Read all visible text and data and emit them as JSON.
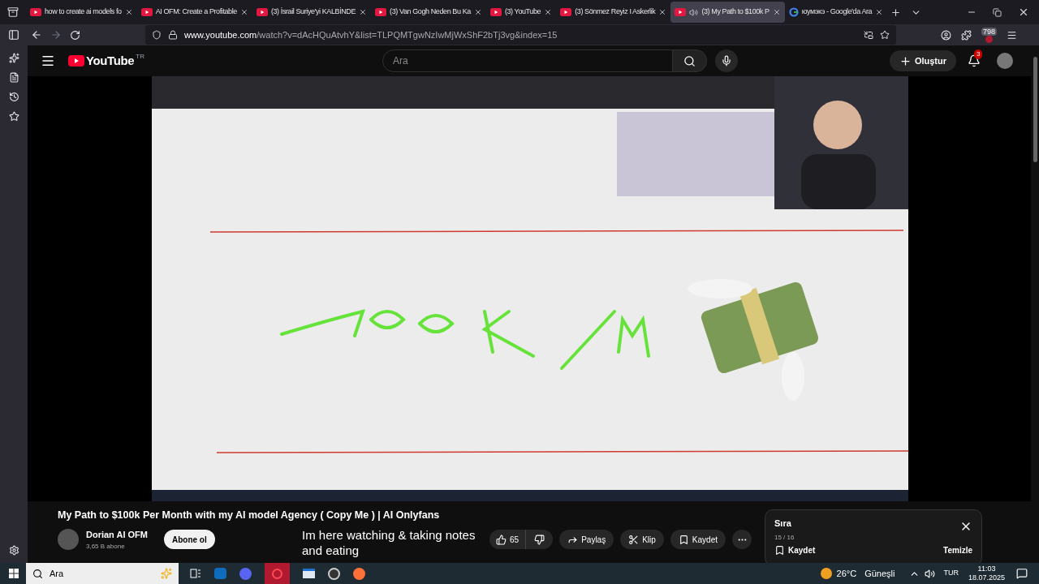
{
  "browser": {
    "tabs": [
      {
        "title": "how to create ai models fo",
        "kind": "youtube",
        "selected": false,
        "audio": false
      },
      {
        "title": "AI OFM: Create a Profitable",
        "kind": "youtube",
        "selected": false,
        "audio": false
      },
      {
        "title": "(3) İsrail Suriye'yi KALBİNDE",
        "kind": "youtube",
        "selected": false,
        "audio": false
      },
      {
        "title": "(3) Van Gogh Neden Bu Ka",
        "kind": "youtube",
        "selected": false,
        "audio": false
      },
      {
        "title": "(3) YouTube",
        "kind": "youtube",
        "selected": false,
        "audio": false
      },
      {
        "title": "(3) Sönmez Reyiz I Askerlik",
        "kind": "youtube",
        "selected": false,
        "audio": false
      },
      {
        "title": "(3) My Path to $100k P",
        "kind": "youtube",
        "selected": true,
        "audio": true
      },
      {
        "title": "юумэкэ - Google'da Ara",
        "kind": "google",
        "selected": false,
        "audio": false
      }
    ],
    "url_host": "www.youtube.com",
    "url_path": "/watch?v=dAcHQuAtvhY&list=TLPQMTgwNzIwMjWxShF2bTj3vg&index=15",
    "extension_badge": "798"
  },
  "youtube": {
    "logo": "YouTube",
    "region": "TR",
    "search_placeholder": "Ara",
    "create": "Oluştur",
    "notifications": "3"
  },
  "title": "My Path to $100k Per Month with my AI model Agency ( Copy Me ) | AI Onlyfans",
  "channel": {
    "name": "Dorian AI OFM",
    "subscribers": "3,65 B abone",
    "subscribe": "Abone ol"
  },
  "actions": {
    "likes": "65",
    "share": "Paylaş",
    "clip": "Klip",
    "save": "Kaydet"
  },
  "queue": {
    "title": "Sıra",
    "position": "15 / 16",
    "save": "Kaydet",
    "clear": "Temizle"
  },
  "subtitle": [
    "Im here watching & taking notes",
    "and eating"
  ],
  "taskbar": {
    "search": "Ara",
    "temperature": "26°C",
    "weather": "Güneşli",
    "language": "TUR",
    "time": "11:03",
    "date": "18.07.2025"
  }
}
